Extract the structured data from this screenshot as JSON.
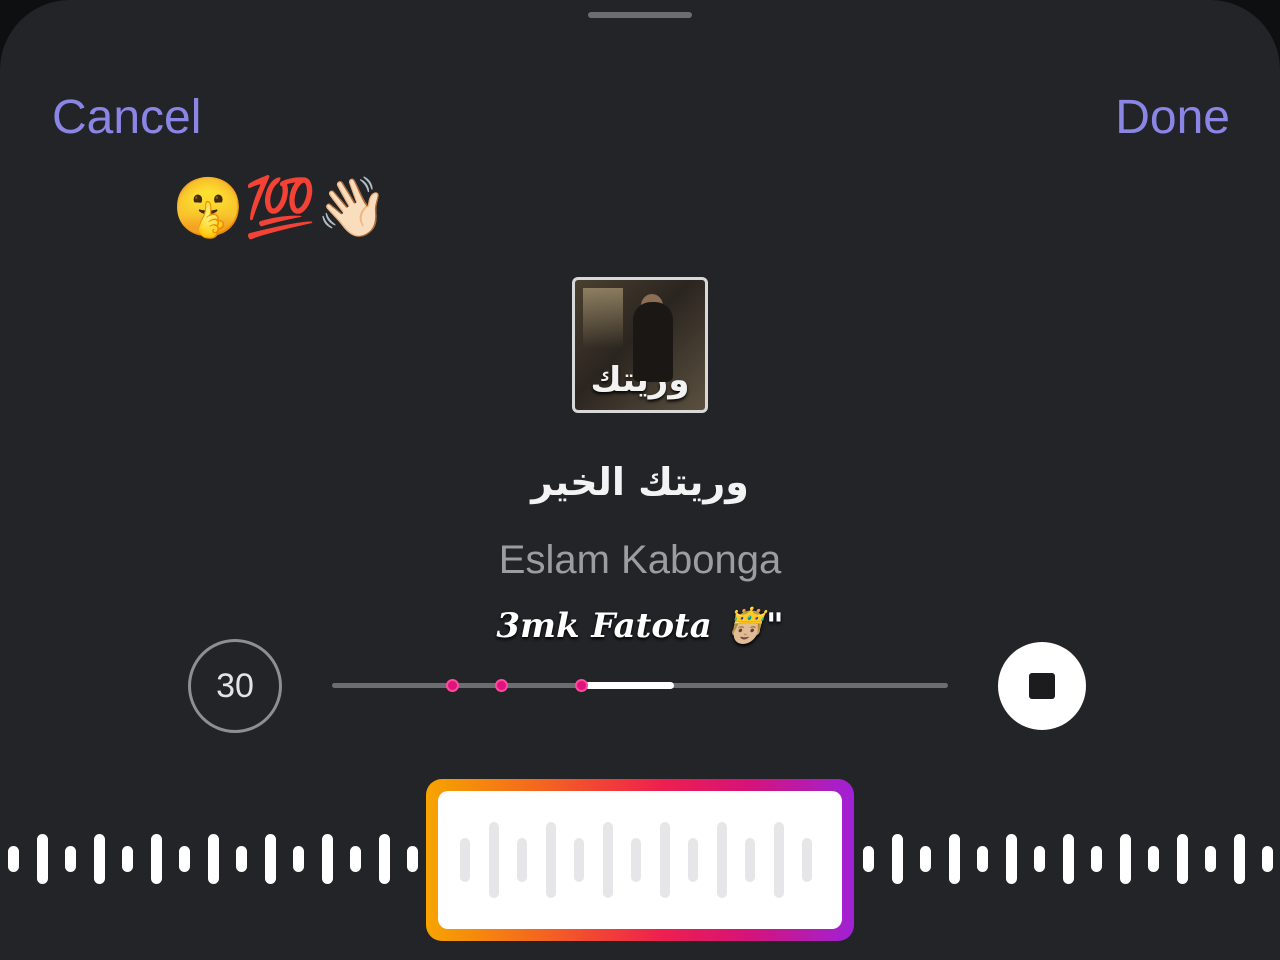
{
  "header": {
    "cancel_label": "Cancel",
    "done_label": "Done"
  },
  "overlay": {
    "emoji_row": "🤫💯👋🏻",
    "caption": "3mk Fatota 🤴🏼\""
  },
  "track": {
    "cover_text": "وريتك",
    "title": "وريتك الخير",
    "artist": "Eslam Kabonga",
    "clip_duration": "30",
    "clip_selection": {
      "start_fraction": 0.41,
      "end_fraction": 0.555
    },
    "markers": [
      0.195,
      0.275,
      0.405
    ]
  },
  "colors": {
    "accent": "#8b86e6",
    "sheet_background": "#232428",
    "marker": "#e0127c",
    "selector_gradient": [
      "#f7a400",
      "#ee1f4e",
      "#a021d6"
    ]
  },
  "icons": {
    "stop": "stop-icon"
  }
}
